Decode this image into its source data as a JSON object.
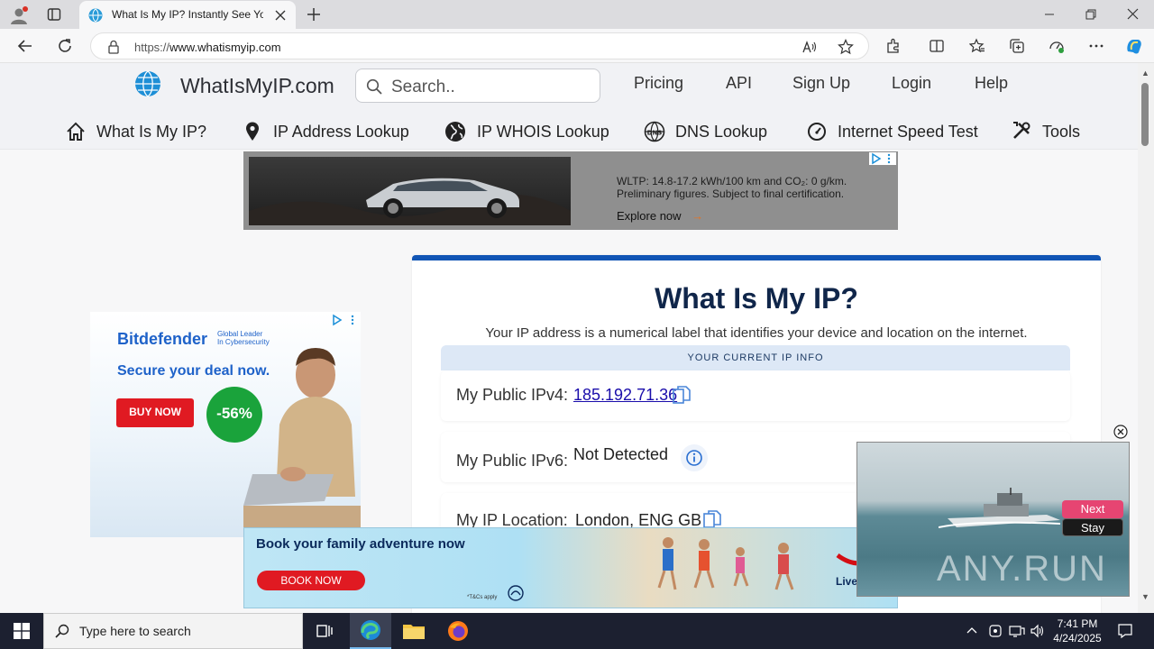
{
  "browser": {
    "tab_title": "What Is My IP? Instantly See Your",
    "url_prefix": "https://",
    "url_host": "www.whatismyip.com"
  },
  "site": {
    "logo_text": "WhatIsMyIP.com",
    "search_placeholder": "Search..",
    "top_nav": [
      "Pricing",
      "API",
      "Sign Up",
      "Login",
      "Help"
    ],
    "main_nav": [
      "What Is My IP?",
      "IP Address Lookup",
      "IP WHOIS Lookup",
      "DNS Lookup",
      "Internet Speed Test",
      "Tools"
    ]
  },
  "ads": {
    "top": {
      "line1": "WLTP: 14.8-17.2 kWh/100 km and CO₂: 0 g/km.",
      "line2": "Preliminary figures. Subject to final certification.",
      "cta": "Explore now"
    },
    "left": {
      "brand": "Bitdefender",
      "tagline_1": "Global Leader",
      "tagline_2": "In Cybersecurity",
      "headline": "Secure your deal now.",
      "button": "BUY NOW",
      "discount": "-56%"
    },
    "bottom": {
      "headline": "Book your family adventure now",
      "button": "BOOK NOW",
      "fineprint": "*T&Cs apply",
      "brand_fragment": "Live"
    }
  },
  "main": {
    "title": "What Is My IP?",
    "subtitle": "Your IP address is a numerical label that identifies your device and location on the internet.",
    "info_header": "YOUR CURRENT IP INFO",
    "rows": [
      {
        "label": "My Public IPv4:",
        "value": "185.192.71.36"
      },
      {
        "label": "My Public IPv6:",
        "value": "Not Detected"
      },
      {
        "label": "My IP Location:",
        "value": "London, ENG GB"
      }
    ]
  },
  "video": {
    "next_label": "Next",
    "stay_label": "Stay",
    "watermark": "ANY.RUN"
  },
  "taskbar": {
    "search_placeholder": "Type here to search",
    "time": "7:41 PM",
    "date": "4/24/2025"
  },
  "colors": {
    "accent_blue": "#1155b5",
    "title_navy": "#10264a",
    "info_bar": "#dde8f6",
    "link": "#1a0dab",
    "buy_red": "#e01a22",
    "discount_green": "#1aa33b"
  }
}
